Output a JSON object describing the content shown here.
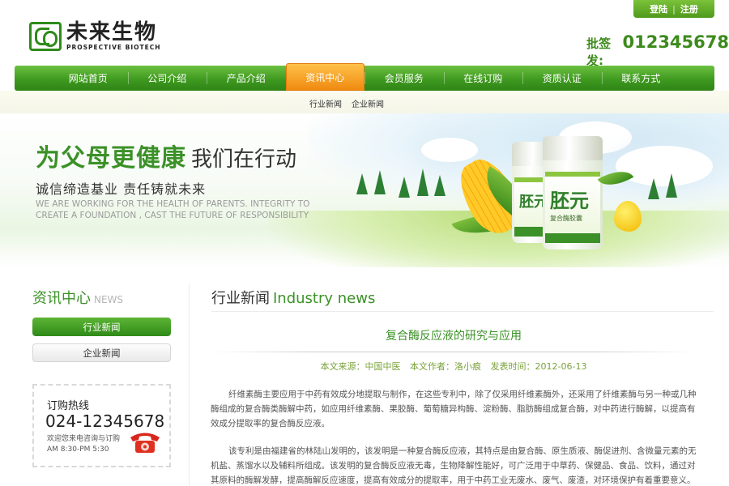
{
  "header": {
    "login_label": "登陆",
    "register_label": "注册",
    "auth_separator": "|",
    "logo_cn": "未来生物",
    "logo_en": "PROSPECTIVE BIOTECH",
    "hotline_label": "批签发:",
    "hotline_number": "012345678"
  },
  "nav": {
    "items": [
      {
        "label": "网站首页"
      },
      {
        "label": "公司介绍"
      },
      {
        "label": "产品介绍"
      },
      {
        "label": "资讯中心",
        "active": true
      },
      {
        "label": "会员服务"
      },
      {
        "label": "在线订购"
      },
      {
        "label": "资质认证"
      },
      {
        "label": "联系方式"
      }
    ],
    "subnav": [
      "行业新闻",
      "企业新闻"
    ]
  },
  "banner": {
    "slogan_green": "为父母更健康",
    "slogan_dark": "我们在行动",
    "slogan_line2": "诚信缔造基业  责任铸就未来",
    "slogan_en": "WE ARE WORKING FOR THE HEALTH OF PARENTS. INTEGRITY TO CREATE A FOUNDATION , CAST THE FUTURE OF RESPONSIBILITY",
    "product_name": "胚元",
    "product_sub": "复合酶胶囊"
  },
  "sidebar": {
    "title_cn": "资讯中心",
    "title_en": "NEWS",
    "buttons": [
      "行业新闻",
      "企业新闻"
    ],
    "hotline_title": "订购热线",
    "hotline_number": "024-12345678",
    "hotline_desc1": "欢迎您来电咨询与订购",
    "hotline_desc2": "AM 8:30-PM 5:30"
  },
  "main": {
    "title_cn": "行业新闻",
    "title_en": "Industry news",
    "article_title": "复合酶反应液的研究与应用",
    "meta_source": "本文来源：中国中医",
    "meta_author": "本文作者：洛小痕",
    "meta_date": "发表时间：2012-06-13",
    "para1": "纤维素酶主要应用于中药有效成分地提取与制作，在这些专利中，除了仅采用纤维素酶外，还采用了纤维素酶与另一种或几种酶组成的复合酶类酶解中药，如应用纤维素酶、果胶酶、葡萄糖异构酶、淀粉酶、脂肪酶组成复合酶，对中药进行酶解，以提高有效成分提取率的复合酶反应液。",
    "para2": "该专利是由福建省的林陆山发明的，该发明是一种复合酶反应液，其特点是由复合酶、原生质液、酶促进剂、含微量元素的无机盐、蒸馏水以及辅料所组成。该发明的复合酶反应液无毒，生物降解性能好，可广泛用于中草药、保健品、食品、饮料，通过对其原料的酶解发酵，提高酶解反应速度，提高有效成分的提取率，用于中药工业无废水、废气、废渣，对环境保护有着重要意义。"
  },
  "colors": {
    "brand_green": "#3b9127",
    "nav_active_orange": "#f08a10"
  }
}
